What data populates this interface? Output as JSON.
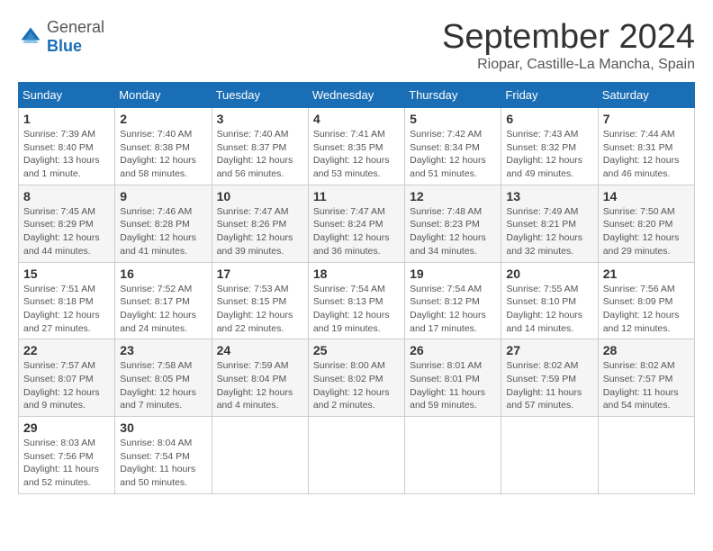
{
  "logo": {
    "general": "General",
    "blue": "Blue"
  },
  "title": "September 2024",
  "location": "Riopar, Castille-La Mancha, Spain",
  "headers": [
    "Sunday",
    "Monday",
    "Tuesday",
    "Wednesday",
    "Thursday",
    "Friday",
    "Saturday"
  ],
  "weeks": [
    [
      {
        "day": "1",
        "lines": [
          "Sunrise: 7:39 AM",
          "Sunset: 8:40 PM",
          "Daylight: 13 hours",
          "and 1 minute."
        ]
      },
      {
        "day": "2",
        "lines": [
          "Sunrise: 7:40 AM",
          "Sunset: 8:38 PM",
          "Daylight: 12 hours",
          "and 58 minutes."
        ]
      },
      {
        "day": "3",
        "lines": [
          "Sunrise: 7:40 AM",
          "Sunset: 8:37 PM",
          "Daylight: 12 hours",
          "and 56 minutes."
        ]
      },
      {
        "day": "4",
        "lines": [
          "Sunrise: 7:41 AM",
          "Sunset: 8:35 PM",
          "Daylight: 12 hours",
          "and 53 minutes."
        ]
      },
      {
        "day": "5",
        "lines": [
          "Sunrise: 7:42 AM",
          "Sunset: 8:34 PM",
          "Daylight: 12 hours",
          "and 51 minutes."
        ]
      },
      {
        "day": "6",
        "lines": [
          "Sunrise: 7:43 AM",
          "Sunset: 8:32 PM",
          "Daylight: 12 hours",
          "and 49 minutes."
        ]
      },
      {
        "day": "7",
        "lines": [
          "Sunrise: 7:44 AM",
          "Sunset: 8:31 PM",
          "Daylight: 12 hours",
          "and 46 minutes."
        ]
      }
    ],
    [
      {
        "day": "8",
        "lines": [
          "Sunrise: 7:45 AM",
          "Sunset: 8:29 PM",
          "Daylight: 12 hours",
          "and 44 minutes."
        ]
      },
      {
        "day": "9",
        "lines": [
          "Sunrise: 7:46 AM",
          "Sunset: 8:28 PM",
          "Daylight: 12 hours",
          "and 41 minutes."
        ]
      },
      {
        "day": "10",
        "lines": [
          "Sunrise: 7:47 AM",
          "Sunset: 8:26 PM",
          "Daylight: 12 hours",
          "and 39 minutes."
        ]
      },
      {
        "day": "11",
        "lines": [
          "Sunrise: 7:47 AM",
          "Sunset: 8:24 PM",
          "Daylight: 12 hours",
          "and 36 minutes."
        ]
      },
      {
        "day": "12",
        "lines": [
          "Sunrise: 7:48 AM",
          "Sunset: 8:23 PM",
          "Daylight: 12 hours",
          "and 34 minutes."
        ]
      },
      {
        "day": "13",
        "lines": [
          "Sunrise: 7:49 AM",
          "Sunset: 8:21 PM",
          "Daylight: 12 hours",
          "and 32 minutes."
        ]
      },
      {
        "day": "14",
        "lines": [
          "Sunrise: 7:50 AM",
          "Sunset: 8:20 PM",
          "Daylight: 12 hours",
          "and 29 minutes."
        ]
      }
    ],
    [
      {
        "day": "15",
        "lines": [
          "Sunrise: 7:51 AM",
          "Sunset: 8:18 PM",
          "Daylight: 12 hours",
          "and 27 minutes."
        ]
      },
      {
        "day": "16",
        "lines": [
          "Sunrise: 7:52 AM",
          "Sunset: 8:17 PM",
          "Daylight: 12 hours",
          "and 24 minutes."
        ]
      },
      {
        "day": "17",
        "lines": [
          "Sunrise: 7:53 AM",
          "Sunset: 8:15 PM",
          "Daylight: 12 hours",
          "and 22 minutes."
        ]
      },
      {
        "day": "18",
        "lines": [
          "Sunrise: 7:54 AM",
          "Sunset: 8:13 PM",
          "Daylight: 12 hours",
          "and 19 minutes."
        ]
      },
      {
        "day": "19",
        "lines": [
          "Sunrise: 7:54 AM",
          "Sunset: 8:12 PM",
          "Daylight: 12 hours",
          "and 17 minutes."
        ]
      },
      {
        "day": "20",
        "lines": [
          "Sunrise: 7:55 AM",
          "Sunset: 8:10 PM",
          "Daylight: 12 hours",
          "and 14 minutes."
        ]
      },
      {
        "day": "21",
        "lines": [
          "Sunrise: 7:56 AM",
          "Sunset: 8:09 PM",
          "Daylight: 12 hours",
          "and 12 minutes."
        ]
      }
    ],
    [
      {
        "day": "22",
        "lines": [
          "Sunrise: 7:57 AM",
          "Sunset: 8:07 PM",
          "Daylight: 12 hours",
          "and 9 minutes."
        ]
      },
      {
        "day": "23",
        "lines": [
          "Sunrise: 7:58 AM",
          "Sunset: 8:05 PM",
          "Daylight: 12 hours",
          "and 7 minutes."
        ]
      },
      {
        "day": "24",
        "lines": [
          "Sunrise: 7:59 AM",
          "Sunset: 8:04 PM",
          "Daylight: 12 hours",
          "and 4 minutes."
        ]
      },
      {
        "day": "25",
        "lines": [
          "Sunrise: 8:00 AM",
          "Sunset: 8:02 PM",
          "Daylight: 12 hours",
          "and 2 minutes."
        ]
      },
      {
        "day": "26",
        "lines": [
          "Sunrise: 8:01 AM",
          "Sunset: 8:01 PM",
          "Daylight: 11 hours",
          "and 59 minutes."
        ]
      },
      {
        "day": "27",
        "lines": [
          "Sunrise: 8:02 AM",
          "Sunset: 7:59 PM",
          "Daylight: 11 hours",
          "and 57 minutes."
        ]
      },
      {
        "day": "28",
        "lines": [
          "Sunrise: 8:02 AM",
          "Sunset: 7:57 PM",
          "Daylight: 11 hours",
          "and 54 minutes."
        ]
      }
    ],
    [
      {
        "day": "29",
        "lines": [
          "Sunrise: 8:03 AM",
          "Sunset: 7:56 PM",
          "Daylight: 11 hours",
          "and 52 minutes."
        ]
      },
      {
        "day": "30",
        "lines": [
          "Sunrise: 8:04 AM",
          "Sunset: 7:54 PM",
          "Daylight: 11 hours",
          "and 50 minutes."
        ]
      },
      {
        "day": "",
        "lines": []
      },
      {
        "day": "",
        "lines": []
      },
      {
        "day": "",
        "lines": []
      },
      {
        "day": "",
        "lines": []
      },
      {
        "day": "",
        "lines": []
      }
    ]
  ]
}
